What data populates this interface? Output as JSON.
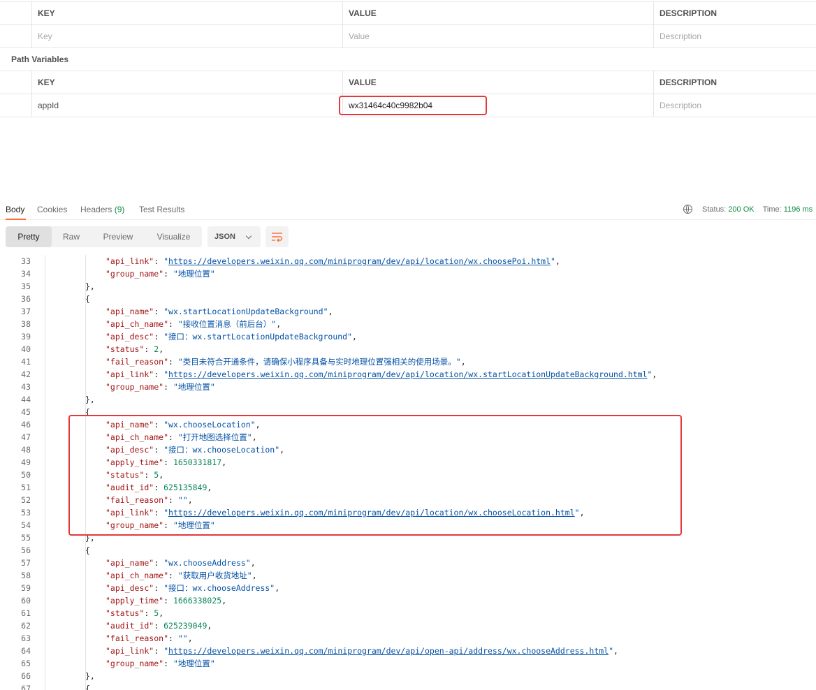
{
  "query_params": {
    "headers": [
      "KEY",
      "VALUE",
      "DESCRIPTION"
    ],
    "placeholders": {
      "key": "Key",
      "value": "Value",
      "description": "Description"
    }
  },
  "path_variables": {
    "title": "Path Variables",
    "headers": [
      "KEY",
      "VALUE",
      "DESCRIPTION"
    ],
    "rows": [
      {
        "key": "appId",
        "value": "wx31464c40c9982b04",
        "description_placeholder": "Description"
      }
    ]
  },
  "response": {
    "tabs": [
      {
        "label": "Body",
        "active": true
      },
      {
        "label": "Cookies"
      },
      {
        "label": "Headers",
        "count": "(9)"
      },
      {
        "label": "Test Results"
      }
    ],
    "status_label": "Status:",
    "status_value": "200 OK",
    "time_label": "Time:",
    "time_value": "1196 ms",
    "views": [
      "Pretty",
      "Raw",
      "Preview",
      "Visualize"
    ],
    "active_view": "Pretty",
    "format": "JSON",
    "icons": {
      "globe": "globe-icon",
      "chevron": "chevron-down-icon",
      "wrap": "wrap-lines-icon"
    }
  },
  "code_lines": [
    {
      "n": 33,
      "indent": 2,
      "parts": [
        [
          "k",
          "\"api_link\""
        ],
        [
          "p",
          ": "
        ],
        [
          "s",
          "\""
        ],
        [
          "l",
          "https://developers.weixin.qq.com/miniprogram/dev/api/location/wx.choosePoi.html"
        ],
        [
          "s",
          "\""
        ],
        [
          "p",
          ","
        ]
      ]
    },
    {
      "n": 34,
      "indent": 2,
      "parts": [
        [
          "k",
          "\"group_name\""
        ],
        [
          "p",
          ": "
        ],
        [
          "s",
          "\"地理位置\""
        ]
      ]
    },
    {
      "n": 35,
      "indent": 1,
      "parts": [
        [
          "p",
          "},"
        ]
      ]
    },
    {
      "n": 36,
      "indent": 1,
      "parts": [
        [
          "p",
          "{"
        ]
      ]
    },
    {
      "n": 37,
      "indent": 2,
      "parts": [
        [
          "k",
          "\"api_name\""
        ],
        [
          "p",
          ": "
        ],
        [
          "s",
          "\"wx.startLocationUpdateBackground\""
        ],
        [
          "p",
          ","
        ]
      ]
    },
    {
      "n": 38,
      "indent": 2,
      "parts": [
        [
          "k",
          "\"api_ch_name\""
        ],
        [
          "p",
          ": "
        ],
        [
          "s",
          "\"接收位置消息（前后台）\""
        ],
        [
          "p",
          ","
        ]
      ]
    },
    {
      "n": 39,
      "indent": 2,
      "parts": [
        [
          "k",
          "\"api_desc\""
        ],
        [
          "p",
          ": "
        ],
        [
          "s",
          "\"接口：wx.startLocationUpdateBackground\""
        ],
        [
          "p",
          ","
        ]
      ]
    },
    {
      "n": 40,
      "indent": 2,
      "parts": [
        [
          "k",
          "\"status\""
        ],
        [
          "p",
          ": "
        ],
        [
          "n",
          "2"
        ],
        [
          "p",
          ","
        ]
      ]
    },
    {
      "n": 41,
      "indent": 2,
      "parts": [
        [
          "k",
          "\"fail_reason\""
        ],
        [
          "p",
          ": "
        ],
        [
          "s",
          "\"类目未符合开通条件，请确保小程序具备与实时地理位置强相关的使用场景。\""
        ],
        [
          "p",
          ","
        ]
      ]
    },
    {
      "n": 42,
      "indent": 2,
      "parts": [
        [
          "k",
          "\"api_link\""
        ],
        [
          "p",
          ": "
        ],
        [
          "s",
          "\""
        ],
        [
          "l",
          "https://developers.weixin.qq.com/miniprogram/dev/api/location/wx.startLocationUpdateBackground.html"
        ],
        [
          "s",
          "\""
        ],
        [
          "p",
          ","
        ]
      ]
    },
    {
      "n": 43,
      "indent": 2,
      "parts": [
        [
          "k",
          "\"group_name\""
        ],
        [
          "p",
          ": "
        ],
        [
          "s",
          "\"地理位置\""
        ]
      ]
    },
    {
      "n": 44,
      "indent": 1,
      "parts": [
        [
          "p",
          "},"
        ]
      ]
    },
    {
      "n": 45,
      "indent": 1,
      "parts": [
        [
          "p",
          "{"
        ]
      ]
    },
    {
      "n": 46,
      "indent": 2,
      "parts": [
        [
          "k",
          "\"api_name\""
        ],
        [
          "p",
          ": "
        ],
        [
          "s",
          "\"wx.chooseLocation\""
        ],
        [
          "p",
          ","
        ]
      ]
    },
    {
      "n": 47,
      "indent": 2,
      "parts": [
        [
          "k",
          "\"api_ch_name\""
        ],
        [
          "p",
          ": "
        ],
        [
          "s",
          "\"打开地图选择位置\""
        ],
        [
          "p",
          ","
        ]
      ]
    },
    {
      "n": 48,
      "indent": 2,
      "parts": [
        [
          "k",
          "\"api_desc\""
        ],
        [
          "p",
          ": "
        ],
        [
          "s",
          "\"接口：wx.chooseLocation\""
        ],
        [
          "p",
          ","
        ]
      ]
    },
    {
      "n": 49,
      "indent": 2,
      "parts": [
        [
          "k",
          "\"apply_time\""
        ],
        [
          "p",
          ": "
        ],
        [
          "n",
          "1650331817"
        ],
        [
          "p",
          ","
        ]
      ]
    },
    {
      "n": 50,
      "indent": 2,
      "parts": [
        [
          "k",
          "\"status\""
        ],
        [
          "p",
          ": "
        ],
        [
          "n",
          "5"
        ],
        [
          "p",
          ","
        ]
      ]
    },
    {
      "n": 51,
      "indent": 2,
      "parts": [
        [
          "k",
          "\"audit_id\""
        ],
        [
          "p",
          ": "
        ],
        [
          "n",
          "625135849"
        ],
        [
          "p",
          ","
        ]
      ]
    },
    {
      "n": 52,
      "indent": 2,
      "parts": [
        [
          "k",
          "\"fail_reason\""
        ],
        [
          "p",
          ": "
        ],
        [
          "s",
          "\"\""
        ],
        [
          "p",
          ","
        ]
      ]
    },
    {
      "n": 53,
      "indent": 2,
      "parts": [
        [
          "k",
          "\"api_link\""
        ],
        [
          "p",
          ": "
        ],
        [
          "s",
          "\""
        ],
        [
          "l",
          "https://developers.weixin.qq.com/miniprogram/dev/api/location/wx.chooseLocation.html"
        ],
        [
          "s",
          "\""
        ],
        [
          "p",
          ","
        ]
      ]
    },
    {
      "n": 54,
      "indent": 2,
      "parts": [
        [
          "k",
          "\"group_name\""
        ],
        [
          "p",
          ": "
        ],
        [
          "s",
          "\"地理位置\""
        ]
      ]
    },
    {
      "n": 55,
      "indent": 1,
      "parts": [
        [
          "p",
          "},"
        ]
      ]
    },
    {
      "n": 56,
      "indent": 1,
      "parts": [
        [
          "p",
          "{"
        ]
      ]
    },
    {
      "n": 57,
      "indent": 2,
      "parts": [
        [
          "k",
          "\"api_name\""
        ],
        [
          "p",
          ": "
        ],
        [
          "s",
          "\"wx.chooseAddress\""
        ],
        [
          "p",
          ","
        ]
      ]
    },
    {
      "n": 58,
      "indent": 2,
      "parts": [
        [
          "k",
          "\"api_ch_name\""
        ],
        [
          "p",
          ": "
        ],
        [
          "s",
          "\"获取用户收货地址\""
        ],
        [
          "p",
          ","
        ]
      ]
    },
    {
      "n": 59,
      "indent": 2,
      "parts": [
        [
          "k",
          "\"api_desc\""
        ],
        [
          "p",
          ": "
        ],
        [
          "s",
          "\"接口：wx.chooseAddress\""
        ],
        [
          "p",
          ","
        ]
      ]
    },
    {
      "n": 60,
      "indent": 2,
      "parts": [
        [
          "k",
          "\"apply_time\""
        ],
        [
          "p",
          ": "
        ],
        [
          "n",
          "1666338025"
        ],
        [
          "p",
          ","
        ]
      ]
    },
    {
      "n": 61,
      "indent": 2,
      "parts": [
        [
          "k",
          "\"status\""
        ],
        [
          "p",
          ": "
        ],
        [
          "n",
          "5"
        ],
        [
          "p",
          ","
        ]
      ]
    },
    {
      "n": 62,
      "indent": 2,
      "parts": [
        [
          "k",
          "\"audit_id\""
        ],
        [
          "p",
          ": "
        ],
        [
          "n",
          "625239049"
        ],
        [
          "p",
          ","
        ]
      ]
    },
    {
      "n": 63,
      "indent": 2,
      "parts": [
        [
          "k",
          "\"fail_reason\""
        ],
        [
          "p",
          ": "
        ],
        [
          "s",
          "\"\""
        ],
        [
          "p",
          ","
        ]
      ]
    },
    {
      "n": 64,
      "indent": 2,
      "parts": [
        [
          "k",
          "\"api_link\""
        ],
        [
          "p",
          ": "
        ],
        [
          "s",
          "\""
        ],
        [
          "l",
          "https://developers.weixin.qq.com/miniprogram/dev/api/open-api/address/wx.chooseAddress.html"
        ],
        [
          "s",
          "\""
        ],
        [
          "p",
          ","
        ]
      ]
    },
    {
      "n": 65,
      "indent": 2,
      "parts": [
        [
          "k",
          "\"group_name\""
        ],
        [
          "p",
          ": "
        ],
        [
          "s",
          "\"地理位置\""
        ]
      ]
    },
    {
      "n": 66,
      "indent": 1,
      "parts": [
        [
          "p",
          "},"
        ]
      ]
    },
    {
      "n": 67,
      "indent": 1,
      "parts": [
        [
          "p",
          "{"
        ]
      ]
    }
  ],
  "colors": {
    "highlight_box": "#e4393c",
    "accent_tab": "#ff6c37",
    "status_ok": "#0b8a3e",
    "json_key": "#a31515",
    "json_string": "#0451a5",
    "json_number": "#098658"
  }
}
